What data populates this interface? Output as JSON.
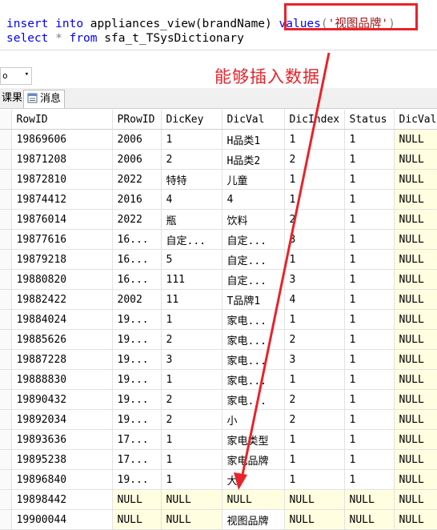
{
  "editor": {
    "line1": {
      "kw_insert": "insert",
      "kw_into": "into",
      "target": "appliances_view(brandName)",
      "kw_values": "values",
      "open": "(",
      "string": "'视图品牌'",
      "close": ")"
    },
    "line2": {
      "kw_select": "select",
      "star": "*",
      "kw_from": "from",
      "table": "sfa_t_TSysDictionary"
    }
  },
  "annotation": {
    "text": "能够插入数据",
    "color": "#e8232a"
  },
  "zoom": {
    "value": "o",
    "arrow": "▾"
  },
  "tabs": {
    "results": "课果",
    "messages": "消息"
  },
  "grid": {
    "columns": [
      "RowID",
      "PRowID",
      "DicKey",
      "DicVal",
      "DicIndex",
      "Status",
      "DicVal"
    ],
    "rows": [
      [
        "19869606",
        "2006",
        "1",
        "H品类1",
        "1",
        "1",
        "NULL"
      ],
      [
        "19871208",
        "2006",
        "2",
        "H品类2",
        "2",
        "1",
        "NULL"
      ],
      [
        "19872810",
        "2022",
        "特特",
        "儿童",
        "1",
        "1",
        "NULL"
      ],
      [
        "19874412",
        "2016",
        "4",
        "4",
        "1",
        "1",
        "NULL"
      ],
      [
        "19876014",
        "2022",
        "瓶",
        "饮料",
        "2",
        "1",
        "NULL"
      ],
      [
        "19877616",
        "16...",
        "自定...",
        "自定...",
        "3",
        "1",
        "NULL"
      ],
      [
        "19879218",
        "16...",
        "5",
        "自定...",
        "1",
        "1",
        "NULL"
      ],
      [
        "19880820",
        "16...",
        "111",
        "自定...",
        "3",
        "1",
        "NULL"
      ],
      [
        "19882422",
        "2002",
        "11",
        "T品牌1",
        "4",
        "1",
        "NULL"
      ],
      [
        "19884024",
        "19...",
        "1",
        "家电...",
        "1",
        "1",
        "NULL"
      ],
      [
        "19885626",
        "19...",
        "2",
        "家电...",
        "2",
        "1",
        "NULL"
      ],
      [
        "19887228",
        "19...",
        "3",
        "家电...",
        "3",
        "1",
        "NULL"
      ],
      [
        "19888830",
        "19...",
        "1",
        "家电...",
        "1",
        "1",
        "NULL"
      ],
      [
        "19890432",
        "19...",
        "2",
        "家电...",
        "2",
        "1",
        "NULL"
      ],
      [
        "19892034",
        "19...",
        "2",
        "小",
        "2",
        "1",
        "NULL"
      ],
      [
        "19893636",
        "17...",
        "1",
        "家电类型",
        "1",
        "1",
        "NULL"
      ],
      [
        "19895238",
        "17...",
        "1",
        "家电品牌",
        "1",
        "1",
        "NULL"
      ],
      [
        "19896840",
        "19...",
        "1",
        "大",
        "1",
        "1",
        "NULL"
      ],
      [
        "19898442",
        "NULL",
        "NULL",
        "NULL",
        "NULL",
        "NULL",
        "NULL"
      ],
      [
        "19900044",
        "NULL",
        "NULL",
        "视图品牌",
        "NULL",
        "NULL",
        "NULL"
      ]
    ]
  },
  "colors": {
    "highlight": "#e8232a",
    "null_cell": "#fffee0",
    "keyword": "#0000ff",
    "string": "#a31515"
  },
  "icons": {
    "messages": "message-icon",
    "annotation": "red-arrow"
  }
}
